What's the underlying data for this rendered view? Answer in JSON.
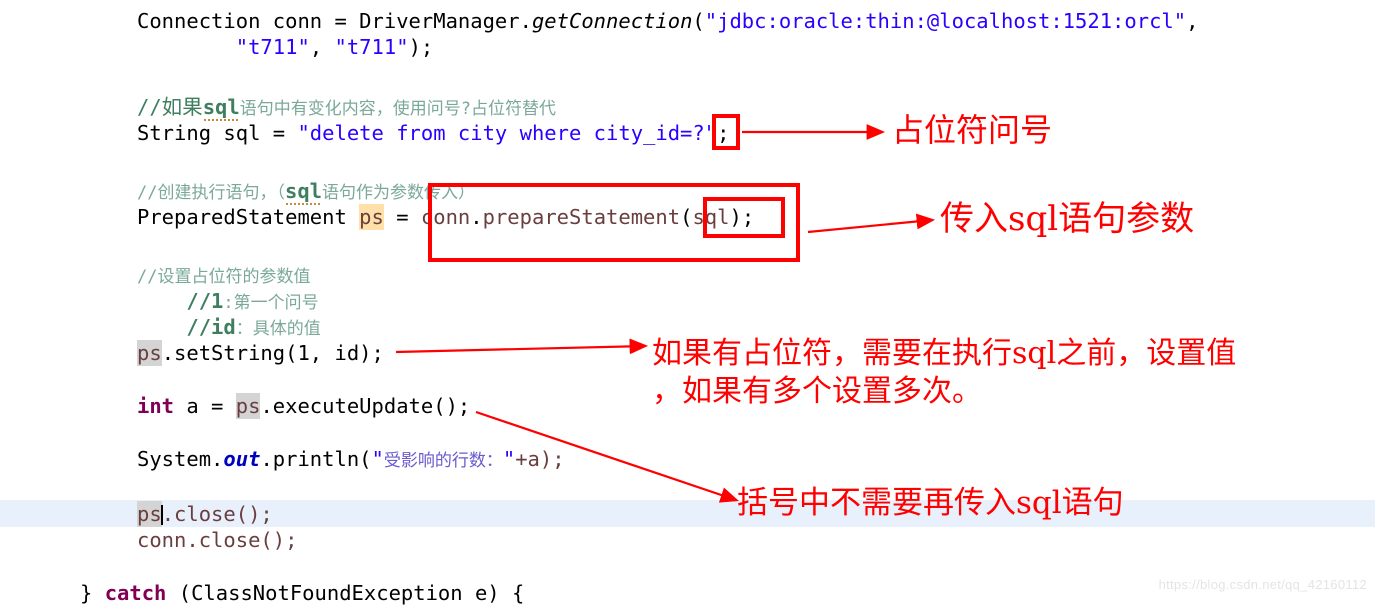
{
  "editor": {
    "font_size_px": 20.5,
    "background": "#ffffff",
    "current_line_background": "#e8f0fb",
    "occurrence_write_background": "#ffe0a8",
    "occurrence_read_background": "#d4d4d4"
  },
  "code": {
    "line1_a": "Connection conn = ",
    "line1_b": "DriverManager",
    "line1_c": ".",
    "line1_d": "getConnection",
    "line1_e": "(",
    "line1_f": "\"jdbc:oracle:thin:@localhost:1521:orcl\"",
    "line1_g": ",",
    "line2_indent": "        ",
    "line2_a": "\"t711\"",
    "line2_b": ", ",
    "line2_c": "\"t711\"",
    "line2_d": ");",
    "line4_comment_head": "//如果",
    "line4_comment_sql": "sql",
    "line4_comment_tail": "语句中有变化内容，使用问号?占位符替代",
    "line5_a": "String sql = ",
    "line5_b": "\"delete from city where city_id=?\"",
    "line5_c": ";",
    "line7_comment_head": "//创建执行语句，（",
    "line7_comment_sql": "sql",
    "line7_comment_tail": "语句作为参数传入）",
    "line8_a": "PreparedStatement ",
    "line8_ps": "ps",
    "line8_b": " = ",
    "line8_c": "conn",
    "line8_d": ".",
    "line8_e": "prepareStatement",
    "line8_f": "(",
    "line8_g": "sql",
    "line8_h": ")",
    "line8_i": ";",
    "line10_comment": "//设置占位符的参数值",
    "line11_indent": "    ",
    "line11_a": "//1",
    "line11_b": ":第一个问号",
    "line12_indent": "    ",
    "line12_a": "//id",
    "line12_b": "：具体的值",
    "line13_ps": "ps",
    "line13_rest": ".setString(1, id);",
    "line15_a": "int",
    "line15_b": " a = ",
    "line15_ps": "ps",
    "line15_c": ".executeUpdate();",
    "line17_a": "System.",
    "line17_b": "out",
    "line17_c": ".println(",
    "line17_d": "\"",
    "line17_e": "受影响的行数：",
    "line17_f": "\"",
    "line17_g": "+a);",
    "line19_ps": "ps",
    "line19_rest": ".close();",
    "line20": "conn.close();",
    "line22_a": "} ",
    "line22_b": "catch",
    "line22_c": " (ClassNotFoundException e) {"
  },
  "annotations": {
    "color": "#ff0000",
    "note_placeholder": "占位符问号",
    "note_pass_sql": "传入sql语句参数",
    "note_set_value_line1": "如果有占位符，需要在执行sql之前，设置值",
    "note_set_value_line2": "，如果有多个设置多次。",
    "note_no_sql_in_parens": "括号中不需要再传入sql语句"
  },
  "watermark": {
    "text": "https://blog.csdn.net/qq_42160112"
  }
}
